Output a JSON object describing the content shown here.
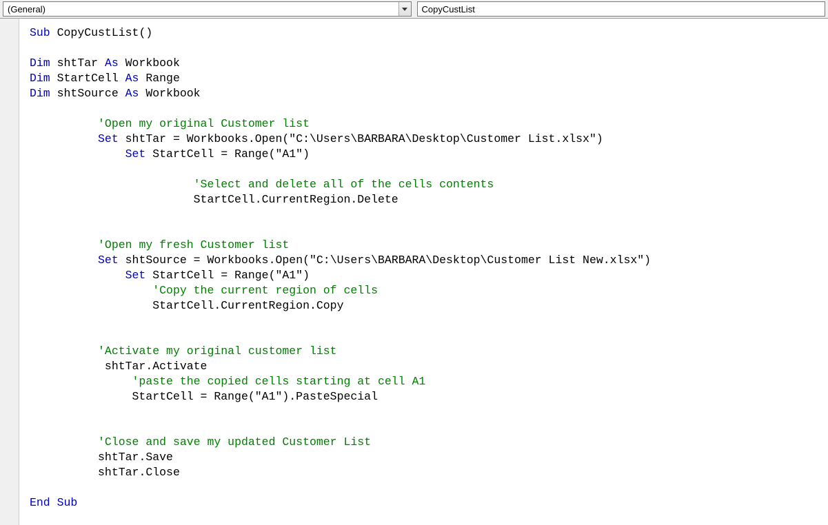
{
  "dropdowns": {
    "object": "(General)",
    "procedure": "CopyCustList"
  },
  "code": {
    "lines": [
      {
        "indent": 0,
        "tokens": [
          {
            "t": "kw",
            "v": "Sub"
          },
          {
            "t": "",
            "v": " CopyCustList()"
          }
        ]
      },
      {
        "indent": 0,
        "tokens": []
      },
      {
        "indent": 0,
        "tokens": [
          {
            "t": "kw",
            "v": "Dim"
          },
          {
            "t": "",
            "v": " shtTar "
          },
          {
            "t": "kw",
            "v": "As"
          },
          {
            "t": "",
            "v": " Workbook"
          }
        ]
      },
      {
        "indent": 0,
        "tokens": [
          {
            "t": "kw",
            "v": "Dim"
          },
          {
            "t": "",
            "v": " StartCell "
          },
          {
            "t": "kw",
            "v": "As"
          },
          {
            "t": "",
            "v": " Range"
          }
        ]
      },
      {
        "indent": 0,
        "tokens": [
          {
            "t": "kw",
            "v": "Dim"
          },
          {
            "t": "",
            "v": " shtSource "
          },
          {
            "t": "kw",
            "v": "As"
          },
          {
            "t": "",
            "v": " Workbook"
          }
        ]
      },
      {
        "indent": 0,
        "tokens": []
      },
      {
        "indent": 10,
        "tokens": [
          {
            "t": "cm",
            "v": "'Open my original Customer list"
          }
        ]
      },
      {
        "indent": 10,
        "tokens": [
          {
            "t": "kw",
            "v": "Set"
          },
          {
            "t": "",
            "v": " shtTar = Workbooks.Open(\"C:\\Users\\BARBARA\\Desktop\\Customer List.xlsx\")"
          }
        ]
      },
      {
        "indent": 14,
        "tokens": [
          {
            "t": "kw",
            "v": "Set"
          },
          {
            "t": "",
            "v": " StartCell = Range(\"A1\")"
          }
        ]
      },
      {
        "indent": 0,
        "tokens": []
      },
      {
        "indent": 24,
        "tokens": [
          {
            "t": "cm",
            "v": "'Select and delete all of the cells contents"
          }
        ]
      },
      {
        "indent": 24,
        "tokens": [
          {
            "t": "",
            "v": "StartCell.CurrentRegion.Delete"
          }
        ]
      },
      {
        "indent": 0,
        "tokens": []
      },
      {
        "indent": 0,
        "tokens": []
      },
      {
        "indent": 10,
        "tokens": [
          {
            "t": "cm",
            "v": "'Open my fresh Customer list"
          }
        ]
      },
      {
        "indent": 10,
        "tokens": [
          {
            "t": "kw",
            "v": "Set"
          },
          {
            "t": "",
            "v": " shtSource = Workbooks.Open(\"C:\\Users\\BARBARA\\Desktop\\Customer List New.xlsx\")"
          }
        ]
      },
      {
        "indent": 14,
        "tokens": [
          {
            "t": "kw",
            "v": "Set"
          },
          {
            "t": "",
            "v": " StartCell = Range(\"A1\")"
          }
        ]
      },
      {
        "indent": 18,
        "tokens": [
          {
            "t": "cm",
            "v": "'Copy the current region of cells"
          }
        ]
      },
      {
        "indent": 18,
        "tokens": [
          {
            "t": "",
            "v": "StartCell.CurrentRegion.Copy"
          }
        ]
      },
      {
        "indent": 0,
        "tokens": []
      },
      {
        "indent": 0,
        "tokens": []
      },
      {
        "indent": 10,
        "tokens": [
          {
            "t": "cm",
            "v": "'Activate my original customer list"
          }
        ]
      },
      {
        "indent": 11,
        "tokens": [
          {
            "t": "",
            "v": "shtTar.Activate"
          }
        ]
      },
      {
        "indent": 15,
        "tokens": [
          {
            "t": "cm",
            "v": "'paste the copied cells starting at cell A1"
          }
        ]
      },
      {
        "indent": 15,
        "tokens": [
          {
            "t": "",
            "v": "StartCell = Range(\"A1\").PasteSpecial"
          }
        ]
      },
      {
        "indent": 0,
        "tokens": []
      },
      {
        "indent": 0,
        "tokens": []
      },
      {
        "indent": 10,
        "tokens": [
          {
            "t": "cm",
            "v": "'Close and save my updated Customer List"
          }
        ]
      },
      {
        "indent": 10,
        "tokens": [
          {
            "t": "",
            "v": "shtTar.Save"
          }
        ]
      },
      {
        "indent": 10,
        "tokens": [
          {
            "t": "",
            "v": "shtTar.Close"
          }
        ]
      },
      {
        "indent": 0,
        "tokens": []
      },
      {
        "indent": 0,
        "tokens": [
          {
            "t": "kw",
            "v": "End Sub"
          }
        ]
      }
    ]
  }
}
